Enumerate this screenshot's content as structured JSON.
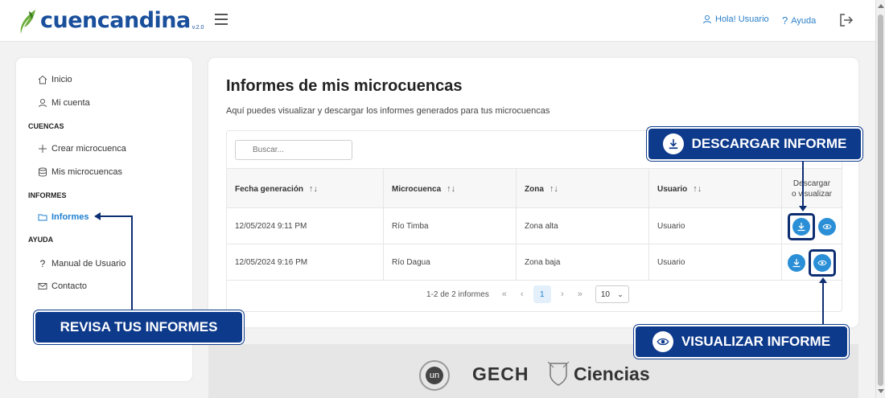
{
  "header": {
    "logo_text": "cuencandina",
    "logo_version": "v.2.0",
    "greeting": "Hola! Usuario",
    "help": "Ayuda"
  },
  "sidebar": {
    "items": [
      {
        "label": "Inicio",
        "icon": "home-icon"
      },
      {
        "label": "Mi cuenta",
        "icon": "user-icon"
      }
    ],
    "section_cuencas": "CUENCAS",
    "cuencas_items": [
      {
        "label": "Crear microcuenca",
        "icon": "plus-icon"
      },
      {
        "label": "Mis microcuencas",
        "icon": "database-icon"
      }
    ],
    "section_informes": "INFORMES",
    "informes_items": [
      {
        "label": "Informes",
        "icon": "folder-icon"
      }
    ],
    "section_ayuda": "AYUDA",
    "ayuda_items": [
      {
        "label": "Manual de Usuario",
        "icon": "question-icon"
      },
      {
        "label": "Contacto",
        "icon": "mail-icon"
      }
    ]
  },
  "main": {
    "title": "Informes de mis microcuencas",
    "subtitle": "Aquí puedes visualizar y descargar los informes generados para tus microcuencas",
    "search_placeholder": "Buscar...",
    "columns": [
      "Fecha generación",
      "Microcuenca",
      "Zona",
      "Usuario"
    ],
    "actions_header_1": "Descargar",
    "actions_header_2": "o visualizar",
    "rows": [
      {
        "fecha": "12/05/2024 9:11 PM",
        "microcuenca": "Río Timba",
        "zona": "Zona alta",
        "usuario": "Usuario"
      },
      {
        "fecha": "12/05/2024 9:16 PM",
        "microcuenca": "Río Dagua",
        "zona": "Zona baja",
        "usuario": "Usuario"
      }
    ],
    "pager": {
      "summary": "1-2 de 2 informes",
      "first": "«",
      "prev": "‹",
      "current": "1",
      "next": "›",
      "last": "»",
      "page_size": "10"
    }
  },
  "footer": {
    "logo_un": "un",
    "logo_gech": "GECH",
    "logo_ciencias": "Ciencias"
  },
  "callouts": {
    "descargar": "DESCARGAR INFORME",
    "visualizar": "VISUALIZAR INFORME",
    "revisa": "REVISA TUS INFORMES"
  },
  "colors": {
    "brand": "#1a4f9c",
    "accent": "#2a8fd6",
    "callout": "#0e3a8c"
  }
}
